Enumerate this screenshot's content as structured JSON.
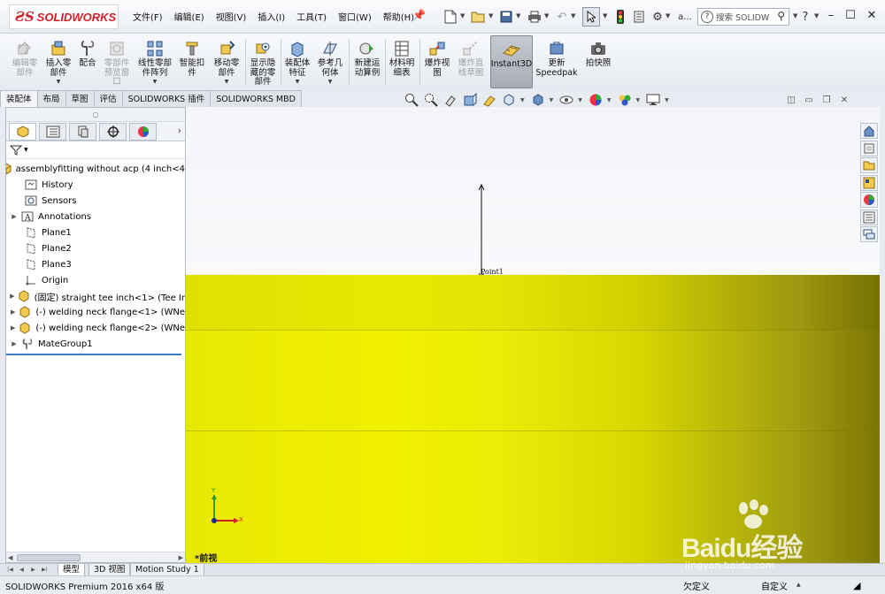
{
  "app": {
    "brand": "SOLIDWORKS",
    "accent_color": "#d0202a"
  },
  "menu": [
    "文件(F)",
    "编辑(E)",
    "视图(V)",
    "插入(I)",
    "工具(T)",
    "窗口(W)",
    "帮助(H)"
  ],
  "quick_access": {
    "doc_name": "a...",
    "search_placeholder": "搜索 SOLIDW"
  },
  "commands": [
    {
      "label": "编辑零\n部件",
      "icon": "edit-component-icon",
      "disabled": true
    },
    {
      "label": "插入零\n部件",
      "icon": "insert-component-icon",
      "disabled": false
    },
    {
      "label": "配合",
      "icon": "mate-icon",
      "disabled": false
    },
    {
      "label": "零部件\n预览窗\n口",
      "icon": "component-preview-icon",
      "disabled": true
    },
    {
      "label": "线性零部\n件阵列",
      "icon": "linear-pattern-icon",
      "disabled": false
    },
    {
      "label": "智能扣\n件",
      "icon": "smart-fastener-icon",
      "disabled": false
    },
    {
      "label": "移动零\n部件",
      "icon": "move-component-icon",
      "disabled": false
    },
    {
      "label": "显示隐\n藏的零\n部件",
      "icon": "show-hidden-icon",
      "disabled": false
    },
    {
      "label": "装配体\n特征",
      "icon": "assembly-feature-icon",
      "disabled": false
    },
    {
      "label": "参考几\n何体",
      "icon": "reference-geometry-icon",
      "disabled": false
    },
    {
      "label": "新建运\n动算例",
      "icon": "motion-study-icon",
      "disabled": false
    },
    {
      "label": "材料明\n细表",
      "icon": "bom-icon",
      "disabled": false
    },
    {
      "label": "爆炸视\n图",
      "icon": "exploded-view-icon",
      "disabled": false
    },
    {
      "label": "爆炸直\n线草图",
      "icon": "explode-line-icon",
      "disabled": true
    },
    {
      "label": "Instant3D",
      "icon": "instant3d-icon",
      "disabled": false
    },
    {
      "label": "更新\nSpeedpak",
      "icon": "speedpak-icon",
      "disabled": false
    },
    {
      "label": "拍快照",
      "icon": "snapshot-icon",
      "disabled": false
    }
  ],
  "cm_tabs": [
    "装配体",
    "布局",
    "草图",
    "评估",
    "SOLIDWORKS 插件",
    "SOLIDWORKS MBD"
  ],
  "tree": [
    {
      "label": "assemblyfitting without acp  (4 inch<4",
      "icon": "assembly-icon",
      "expander": ""
    },
    {
      "label": "History",
      "icon": "history-icon",
      "expander": ""
    },
    {
      "label": "Sensors",
      "icon": "sensors-icon",
      "expander": ""
    },
    {
      "label": "Annotations",
      "icon": "annotations-icon",
      "expander": "▶"
    },
    {
      "label": "Plane1",
      "icon": "plane-icon",
      "expander": ""
    },
    {
      "label": "Plane2",
      "icon": "plane-icon",
      "expander": ""
    },
    {
      "label": "Plane3",
      "icon": "plane-icon",
      "expander": ""
    },
    {
      "label": "Origin",
      "icon": "origin-icon",
      "expander": ""
    },
    {
      "label": "(固定) straight tee inch<1> (Tee Ir",
      "icon": "part-icon",
      "expander": "▶"
    },
    {
      "label": "(-) welding neck flange<1> (WNe",
      "icon": "part-icon",
      "expander": "▶"
    },
    {
      "label": "(-) welding neck flange<2> (WNe",
      "icon": "part-icon",
      "expander": "▶"
    },
    {
      "label": "MateGroup1",
      "icon": "mategroup-icon",
      "expander": "▶"
    }
  ],
  "viewport": {
    "point_label": "Point1",
    "view_label": "*前视",
    "model_color": "#eeed00",
    "triad": {
      "x": "X",
      "y": "Y"
    }
  },
  "bottom_tabs": [
    "模型",
    "3D 视图",
    "Motion Study 1"
  ],
  "status": {
    "left": "SOLIDWORKS Premium 2016 x64 版",
    "under_defined": "欠定义",
    "custom": "自定义"
  },
  "watermark": {
    "text": "Baidu经验",
    "url": "jingyan.baidu.com"
  }
}
